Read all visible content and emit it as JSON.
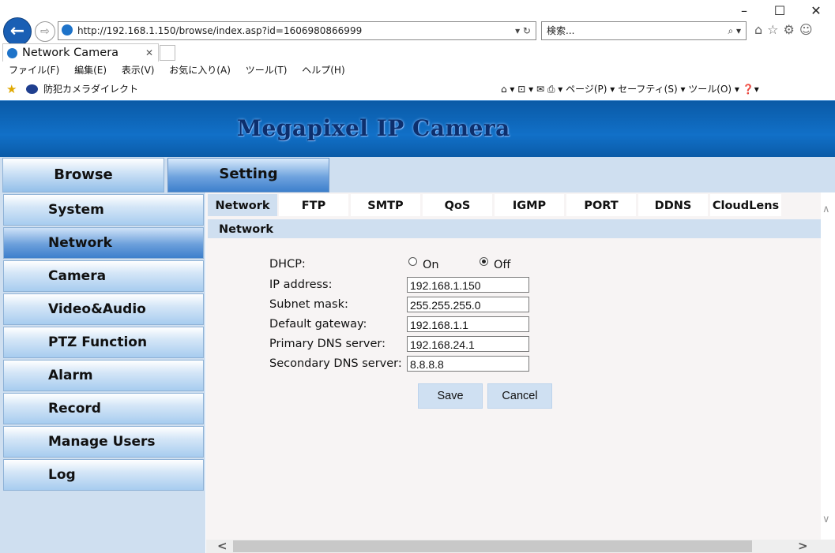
{
  "browser": {
    "window_controls": {
      "minimize": "–",
      "maximize": "☐",
      "close": "✕"
    },
    "url": "http://192.168.1.150/browse/index.asp?id=1606980866999",
    "address_controls": "▾ ↻",
    "search_placeholder": "検索...",
    "search_glyph": "⌕ ▾",
    "toolbar_icons": "⌂☆⚙☺",
    "tab_title": "Network Camera",
    "tab_close": "✕",
    "menu": [
      "ファイル(F)",
      "編集(E)",
      "表示(V)",
      "お気に入り(A)",
      "ツール(T)",
      "ヘルプ(H)"
    ],
    "favorite_site": "防犯カメラダイレクト",
    "commands": "⌂ ▾  ⊡ ▾  ✉  ⎙ ▾  ページ(P) ▾  セーフティ(S) ▾  ツール(O) ▾  ❓▾"
  },
  "page": {
    "banner_title": "Megapixel IP Camera",
    "top_nav": {
      "browse": "Browse",
      "setting": "Setting"
    },
    "sidebar": [
      "System",
      "Network",
      "Camera",
      "Video&Audio",
      "PTZ Function",
      "Alarm",
      "Record",
      "Manage Users",
      "Log"
    ],
    "sidebar_active": "Network",
    "subtabs": [
      "Network",
      "FTP",
      "SMTP",
      "QoS",
      "IGMP",
      "PORT",
      "DDNS",
      "CloudLens"
    ],
    "section_title": "Network",
    "form": {
      "dhcp_label": "DHCP:",
      "dhcp_on": "On",
      "dhcp_off": "Off",
      "dhcp_selected": "Off",
      "ip_label": "IP address:",
      "ip_value": "192.168.1.150",
      "subnet_label": "Subnet mask:",
      "subnet_value": "255.255.255.0",
      "gateway_label": "Default gateway:",
      "gateway_value": "192.168.1.1",
      "dns1_label": "Primary DNS server:",
      "dns1_value": "192.168.24.1",
      "dns2_label": "Secondary DNS server:",
      "dns2_value": "8.8.8.8",
      "save": "Save",
      "cancel": "Cancel"
    },
    "scroll": {
      "up": "∧",
      "down": "∨",
      "left": "<",
      "right": ">"
    }
  }
}
